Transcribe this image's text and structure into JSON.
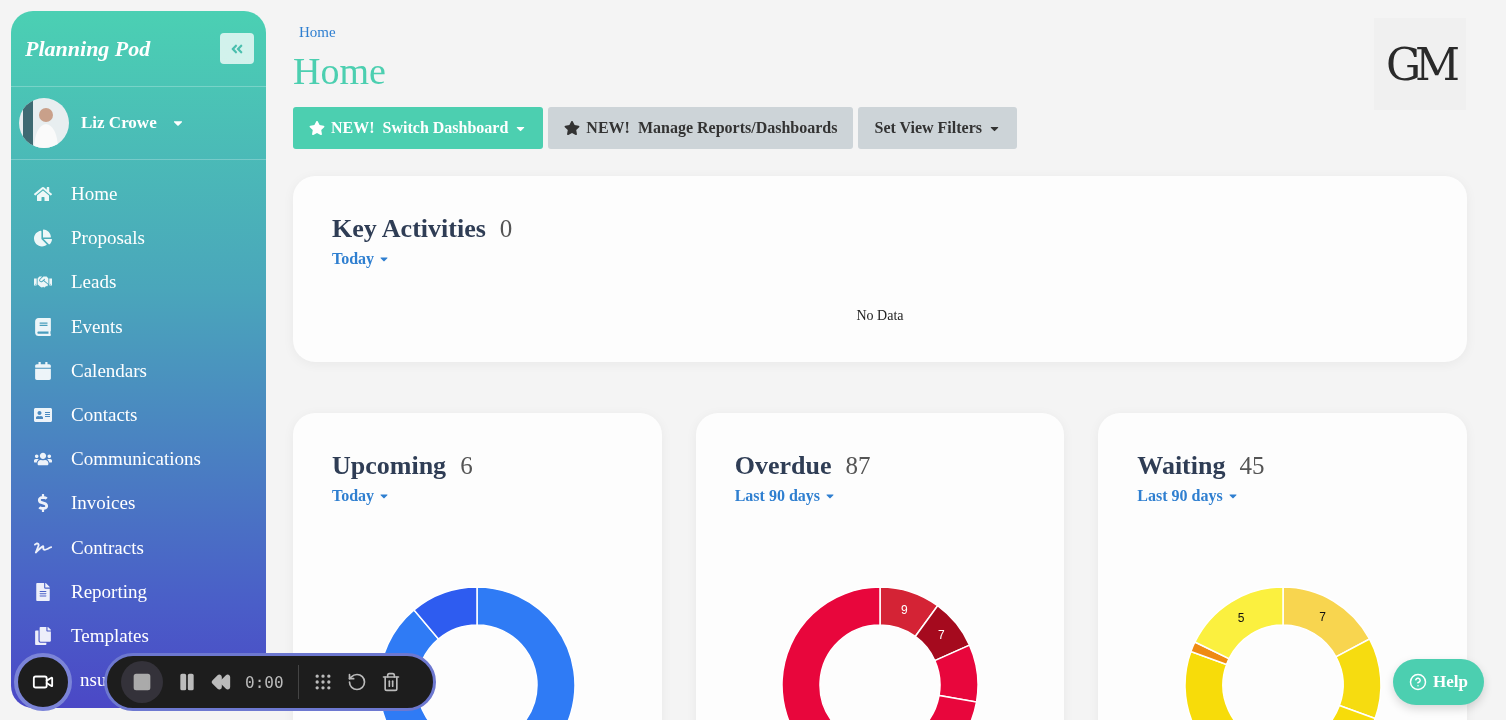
{
  "sidebar": {
    "logo": "Planning Pod",
    "user": {
      "name": "Liz Crowe"
    },
    "items": [
      {
        "label": "Home",
        "kind": "link"
      },
      {
        "label": "Proposals",
        "kind": "link"
      },
      {
        "label": "Leads",
        "kind": "link"
      },
      {
        "label": "Events",
        "kind": "link"
      },
      {
        "label": "Calendars",
        "kind": "link"
      },
      {
        "label": "Contacts",
        "kind": "link"
      },
      {
        "label": "Communications",
        "kind": "link"
      },
      {
        "label": "Invoices",
        "kind": "link"
      },
      {
        "label": "Contracts",
        "kind": "link"
      },
      {
        "label": "Reporting",
        "kind": "link"
      },
      {
        "label": "Templates",
        "kind": "link"
      },
      {
        "label": "nsu",
        "kind": "covered"
      }
    ]
  },
  "breadcrumb": "Home",
  "title": "Home",
  "brand_logo": "GM",
  "toolbar": [
    {
      "label": "NEW!  Switch Dashboard",
      "kind": "primary",
      "star": true,
      "caret": true
    },
    {
      "label": "NEW!  Manage Reports/Dashboards",
      "kind": "secondary",
      "star": true,
      "caret": false
    },
    {
      "label": "Set View Filters",
      "kind": "secondary",
      "star": false,
      "caret": true
    }
  ],
  "key_activities": {
    "title": "Key Activities",
    "count": "0",
    "period": "Today",
    "empty": "No Data"
  },
  "cards": [
    {
      "title": "Upcoming",
      "count": "6",
      "period": "Today",
      "kind": "blue"
    },
    {
      "title": "Overdue",
      "count": "87",
      "period": "Last 90 days",
      "kind": "red",
      "segment_labels": [
        "9",
        "7"
      ]
    },
    {
      "title": "Waiting",
      "count": "45",
      "period": "Last 90 days",
      "kind": "yellow",
      "segment_labels": [
        "5",
        "7"
      ]
    }
  ],
  "recorder": {
    "time": "0:00"
  },
  "help": "Help"
}
